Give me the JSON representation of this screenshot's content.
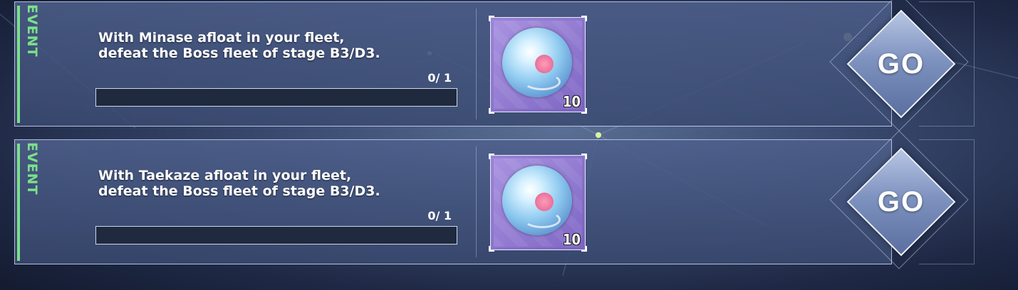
{
  "tasks": [
    {
      "tag": "EVENT",
      "description_line1": "With Minase afloat in your fleet,",
      "description_line2": "defeat the Boss fleet of stage B3/D3.",
      "progress_current": 0,
      "progress_text": "0/ 1",
      "reward_count": "10",
      "reward_icon": "bubble-orb-icon",
      "button_label": "GO"
    },
    {
      "tag": "EVENT",
      "description_line1": "With Taekaze afloat in your fleet,",
      "description_line2": "defeat the Boss fleet of stage B3/D3.",
      "progress_current": 0,
      "progress_text": "0/ 1",
      "reward_count": "10",
      "reward_icon": "bubble-orb-icon",
      "button_label": "GO"
    }
  ],
  "colors": {
    "event_accent": "#7be08a",
    "panel": "#4e608c",
    "reward_frame": "#9b84d6",
    "go_button": "#7f93c0"
  }
}
